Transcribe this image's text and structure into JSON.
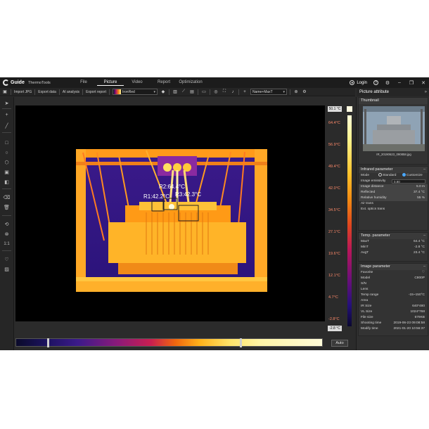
{
  "app": {
    "brand": "Guide",
    "product": "ThermoTools",
    "menu": [
      "File",
      "Picture",
      "Video",
      "Report",
      "Optimization"
    ],
    "active_menu": "Picture",
    "login_label": "Login"
  },
  "toolbar": {
    "import_jpg": "Import JPG",
    "export_data": "Export data",
    "ai_analysis": "AI analysis",
    "export_report": "Export report",
    "palette": "IronRed",
    "label_mode": "Name+MaxT"
  },
  "scale": {
    "max_box": "50.1 °C",
    "min_box": "-2.8 °C",
    "ticks": [
      "64.4°C",
      "56.9°C",
      "49.4°C",
      "42.0°C",
      "34.5°C",
      "27.1°C",
      "19.6°C",
      "12.1°C",
      "4.7°C",
      "-2.8°C"
    ],
    "auto_label": "Auto"
  },
  "rois": [
    {
      "label": "R2:64.4°C"
    },
    {
      "label": "R1:42.2°C"
    },
    {
      "label": "R3:42.3°C"
    }
  ],
  "panel": {
    "title": "Picture attribute",
    "thumbnail": {
      "title": "Thumbnail",
      "filename": "IR_20190623_090858.jpg"
    },
    "infrared": {
      "title": "Infrared parameter",
      "mode_label": "Mode",
      "mode_standard": "Standard",
      "mode_customize": "Customize",
      "rows": [
        {
          "label": "Image emissivity",
          "value": "0.90"
        },
        {
          "label": "Image distance",
          "value": "5.0 m"
        },
        {
          "label": "Reflected",
          "value": "37.4 °C"
        },
        {
          "label": "Relative humidity",
          "value": "55 %"
        },
        {
          "label": "Air trans",
          "value": ""
        },
        {
          "label": "Ext. optics trans",
          "value": ""
        }
      ]
    },
    "temp": {
      "title": "Temp. parameter",
      "rows": [
        {
          "label": "MaxT",
          "value": "64.4 °C"
        },
        {
          "label": "MinT",
          "value": "-2.8 °C"
        },
        {
          "label": "AvgT",
          "value": "23.4 °C"
        }
      ]
    },
    "image": {
      "title": "Image parameter",
      "rows": [
        {
          "label": "Favorite",
          "value": "♡"
        },
        {
          "label": "Model",
          "value": "C800P"
        },
        {
          "label": "S/N",
          "value": ""
        },
        {
          "label": "Lens",
          "value": ""
        },
        {
          "label": "Temp range",
          "value": "-15~150°C"
        },
        {
          "label": "Area",
          "value": ""
        },
        {
          "label": "IR Size",
          "value": "640*480"
        },
        {
          "label": "VL Size",
          "value": "1024*768"
        },
        {
          "label": "File size",
          "value": "679KB"
        },
        {
          "label": "Shooting time",
          "value": "2019-06-23 09:08:58"
        },
        {
          "label": "Modify time",
          "value": "2021-01-20 10:56:37"
        }
      ]
    }
  },
  "colors": {
    "window_bg": "#2b2b2b",
    "canvas_bg": "#000000",
    "accent": "#4aa8ff",
    "tick_color": "#ff8a6a"
  },
  "icons": [
    "save-icon",
    "pointer-icon",
    "crosshair-icon",
    "line-icon",
    "rectangle-icon",
    "circle-icon",
    "polygon-icon",
    "eraser-icon",
    "delete-icon",
    "zoom-icon",
    "one-to-one-icon",
    "heart-icon",
    "histogram-icon",
    "trend-icon",
    "login-icon",
    "help-icon",
    "settings-icon"
  ]
}
